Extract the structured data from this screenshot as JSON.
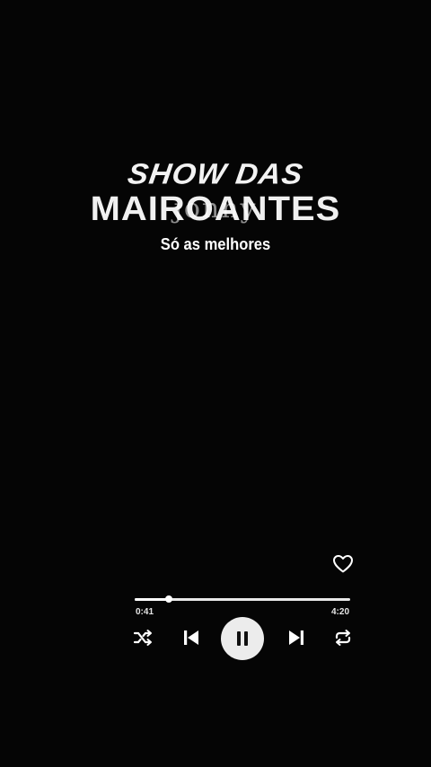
{
  "title": {
    "line1": "SHOW DAS",
    "line2": "MAIROANTES",
    "overlay": "jonny",
    "subtitle": "Só as melhores"
  },
  "player": {
    "progress": 0.16,
    "elapsed": "0:41",
    "total": "4:20",
    "liked": false,
    "state": "playing"
  },
  "icons": {
    "heart": "heart-outline-icon",
    "shuffle": "shuffle-icon",
    "previous": "skip-previous-icon",
    "pause": "pause-icon",
    "next": "skip-next-icon",
    "repeat": "repeat-icon"
  },
  "colors": {
    "background": "#050505",
    "foreground": "#ffffff",
    "play_button": "#ececec"
  }
}
